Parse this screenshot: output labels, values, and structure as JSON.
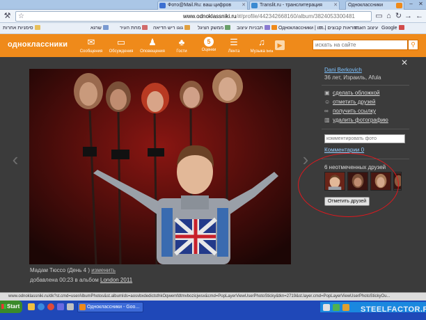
{
  "browser": {
    "tabs": [
      {
        "label": "Фото@Mail.Ru: ваш цифров",
        "icon": "mailru-icon",
        "color": "#3b6fd1"
      },
      {
        "label": "Translit.ru - транслитерация",
        "icon": "translit-icon",
        "color": "#3b8ad1"
      },
      {
        "label": "Одноклассники",
        "icon": "odnoklassniki-icon",
        "color": "#ef8a1a",
        "active": true
      }
    ],
    "new_tab_icon": "new-tab-icon",
    "url_prefix": "www.odnoklassniki.ru",
    "url_rest": "/#/profile/442342668160/album/3824053300481"
  },
  "bookmarks": {
    "folder_label": "סימניות אחרות",
    "items": [
      {
        "label": "שרגא",
        "color": "#7a9ad1"
      },
      {
        "label": "מחת העיר",
        "color": "#d16a6a"
      },
      {
        "label": "גוגו ריש הדיאה",
        "color": "#e0a040"
      },
      {
        "label": "ממשק הציגל",
        "color": "#6aa06a"
      },
      {
        "label": "תבניות עיצוב",
        "color": "#8a7ad1"
      },
      {
        "label": "Одноклассники | תו...",
        "color": "#ef8a1a"
      },
      {
        "label": "הוראות קבוצים | תו...",
        "color": "#d1a06a"
      },
      {
        "label": "עיצוב האתר",
        "color": "#6ab0d1"
      },
      {
        "label": "Google",
        "color": "#d14a4a"
      }
    ]
  },
  "site": {
    "logo": "одноклассники",
    "nav": [
      {
        "label": "Сообщения",
        "icon": "envelope-icon",
        "glyph": "✉"
      },
      {
        "label": "Обсуждения",
        "icon": "discussions-icon",
        "glyph": "▭"
      },
      {
        "label": "Оповещения",
        "icon": "bell-icon",
        "glyph": "♫"
      },
      {
        "label": "Гости",
        "icon": "guests-icon",
        "glyph": "♣"
      },
      {
        "label": "Оценки",
        "icon": "ratings-icon",
        "glyph": "5"
      },
      {
        "label": "Лента",
        "icon": "feed-icon",
        "glyph": "☰"
      },
      {
        "label": "Музыка",
        "icon": "music-icon",
        "glyph": "♪"
      }
    ],
    "music_beta": "beta",
    "search_placeholder": "искать на сайте"
  },
  "viewer": {
    "caption_text": "Мадам Тюссо (День 4 )",
    "caption_link": "изменить",
    "added_prefix": "добавлена 00:23 в альбом",
    "album_link": "London 2011",
    "owner_name": "Dani Berkovich",
    "owner_meta": "36 лет, Израиль, Afula",
    "actions": [
      {
        "label": "сделать обложкой",
        "icon": "cover-icon",
        "glyph": "▣"
      },
      {
        "label": "отметить друзей",
        "icon": "tag-friends-icon",
        "glyph": "☺"
      },
      {
        "label": "получить ссылку",
        "icon": "link-icon",
        "glyph": "∞"
      },
      {
        "label": "удалить фотографию",
        "icon": "trash-icon",
        "glyph": "▥"
      }
    ],
    "comment_placeholder": "комментировать фото",
    "comments_link": "Комментарии 0",
    "untagged_title": "6 неотмеченных друзей",
    "tag_button": "Отметить друзей"
  },
  "status": {
    "text": "www.odnoklassniki.ru/dk?st.cmd=userAlbumPhotos&st.albumIds=aosvbxdedictsthkOqwemfdtmvbozicjwsx&cmd=PopLayerViewUserPhotoSticky&tkn=2719&st.layer.cmd=PopLayerViewUserPhotoStickyOu..."
  },
  "taskbar": {
    "start_label": "Start",
    "task_label": "Одноклассники - Goo...",
    "watermark": "STEELFACTOR.RU"
  }
}
